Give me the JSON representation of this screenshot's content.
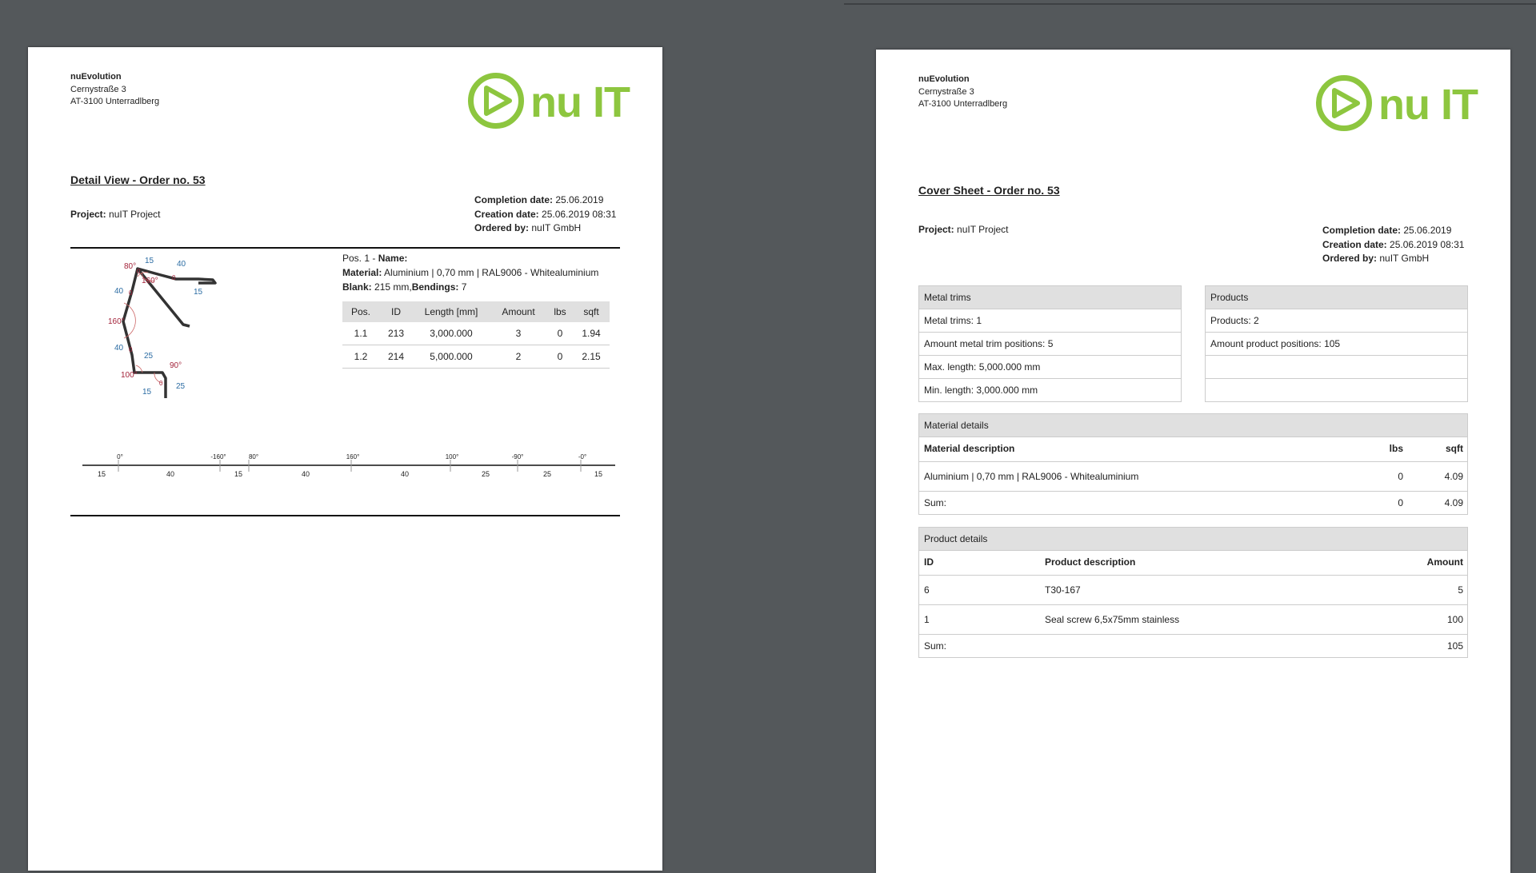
{
  "company": {
    "name": "nuEvolution",
    "street": "Cernystraße 3",
    "city": "AT-3100 Unterradlberg"
  },
  "logo": {
    "text": "nu IT",
    "color": "#8dc63f"
  },
  "detail_page": {
    "title": "Detail View - Order no. 53",
    "project_label": "Project:",
    "project_value": "nuIT Project",
    "completion_label": "Completion date:",
    "completion_value": "25.06.2019",
    "creation_label": "Creation date:",
    "creation_value": "25.06.2019 08:31",
    "ordered_label": "Ordered by:",
    "ordered_value": "nuIT GmbH",
    "position": {
      "pos_prefix": "Pos. 1 -",
      "name_label": "Name:",
      "material_label": "Material:",
      "material_value": "Aluminium | 0,70 mm | RAL9006 - Whitealuminium",
      "blank_label": "Blank:",
      "blank_value": "215 mm,",
      "bendings_label": "Bendings:",
      "bendings_value": "7"
    },
    "table": {
      "headers": [
        "Pos.",
        "ID",
        "Length [mm]",
        "Amount",
        "lbs",
        "sqft"
      ],
      "rows": [
        [
          "1.1",
          "213",
          "3,000.000",
          "3",
          "0",
          "1.94"
        ],
        [
          "1.2",
          "214",
          "5,000.000",
          "2",
          "0",
          "2.15"
        ]
      ]
    },
    "drawing_labels": {
      "lengths": [
        "15",
        "40",
        "15",
        "40",
        "40",
        "25",
        "25",
        "15"
      ],
      "angles": [
        "80°",
        "160°",
        "160°",
        "90°",
        "100°"
      ],
      "zeros": [
        "0",
        "0",
        "0",
        "0",
        "0"
      ]
    },
    "rule": {
      "angles": [
        "0°",
        "-160°",
        "80°",
        "160°",
        "100°",
        "-90°",
        "-0°"
      ],
      "lengths": [
        "15",
        "40",
        "15",
        "40",
        "40",
        "25",
        "25",
        "15"
      ]
    }
  },
  "cover_page": {
    "title": "Cover Sheet - Order no. 53",
    "project_label": "Project:",
    "project_value": "nuIT Project",
    "completion_label": "Completion date:",
    "completion_value": "25.06.2019",
    "creation_label": "Creation date:",
    "creation_value": "25.06.2019 08:31",
    "ordered_label": "Ordered by:",
    "ordered_value": "nuIT GmbH",
    "metal_trims": {
      "header": "Metal trims",
      "rows": [
        "Metal trims: 1",
        "Amount metal trim positions: 5",
        "Max. length: 5,000.000 mm",
        "Min. length: 3,000.000 mm"
      ]
    },
    "products": {
      "header": "Products",
      "rows": [
        "Products: 2",
        "Amount product positions: 105",
        "",
        ""
      ]
    },
    "material_details": {
      "header": "Material details",
      "col_desc": "Material description",
      "col_lbs": "lbs",
      "col_sqft": "sqft",
      "rows": [
        {
          "desc": "Aluminium | 0,70 mm | RAL9006 - Whitealuminium",
          "lbs": "0",
          "sqft": "4.09"
        }
      ],
      "sum_label": "Sum:",
      "sum_lbs": "0",
      "sum_sqft": "4.09"
    },
    "product_details": {
      "header": "Product details",
      "col_id": "ID",
      "col_desc": "Product description",
      "col_amount": "Amount",
      "rows": [
        {
          "id": "6",
          "desc": "T30-167",
          "amount": "5"
        },
        {
          "id": "1",
          "desc": "Seal screw 6,5x75mm stainless",
          "amount": "100"
        }
      ],
      "sum_label": "Sum:",
      "sum_amount": "105"
    }
  }
}
